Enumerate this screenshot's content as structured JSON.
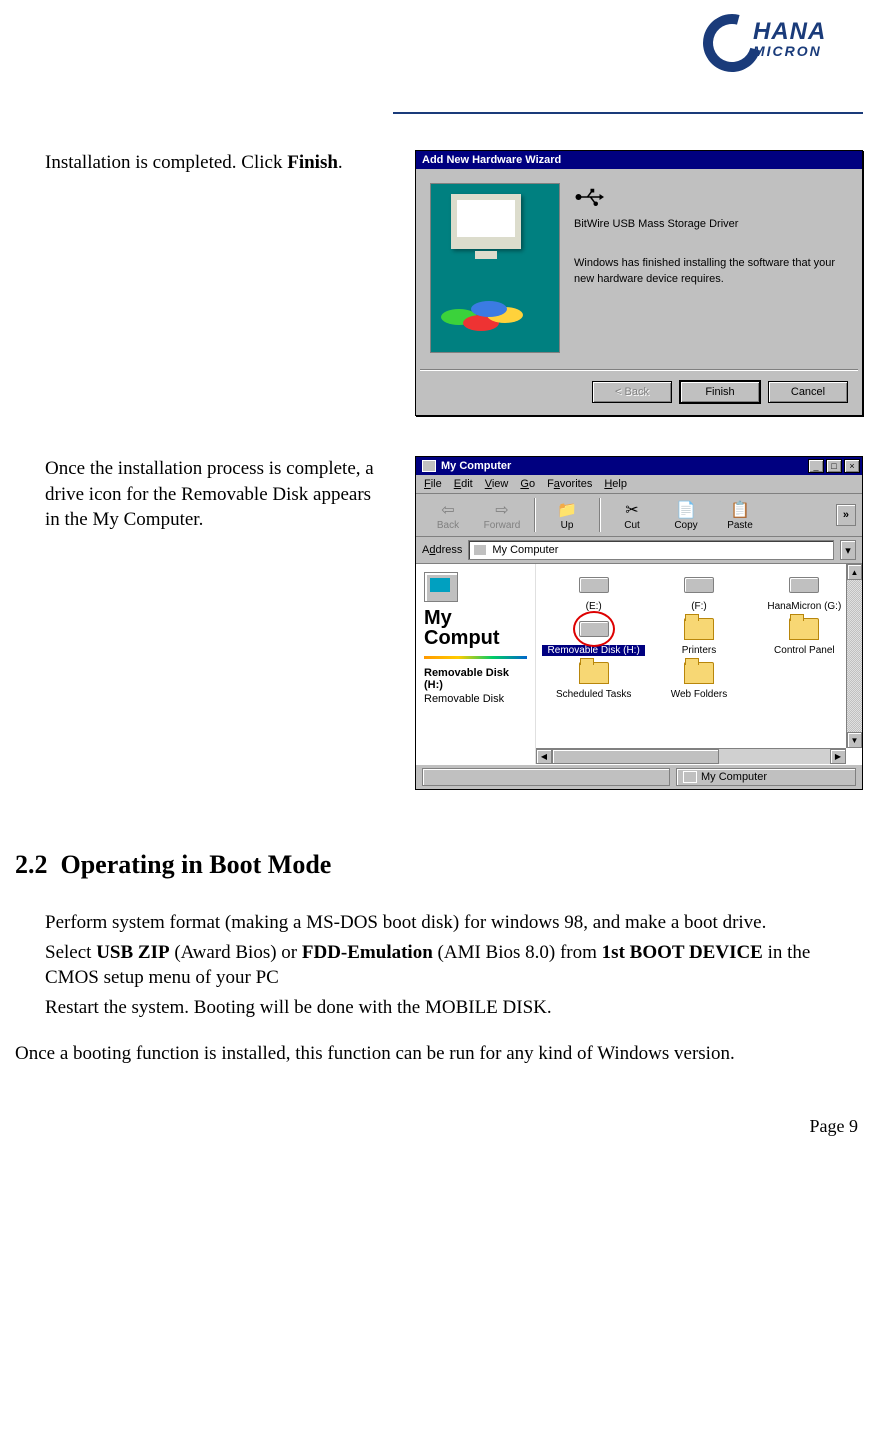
{
  "logo": {
    "line1": "HANA",
    "line2": "MICRON"
  },
  "step1": {
    "text_pre": "Installation is completed.  Click ",
    "text_bold": "Finish",
    "text_post": "."
  },
  "wizard": {
    "title": "Add New Hardware Wizard",
    "driver": "BitWire USB Mass Storage Driver",
    "message": "Windows has finished installing the software that your new hardware device requires.",
    "btn_back": "< Back",
    "btn_finish": "Finish",
    "btn_cancel": "Cancel"
  },
  "step2": {
    "text": "Once the installation process is complete, a drive icon for the Removable Disk appears in the My Computer."
  },
  "mycomp": {
    "title": "My Computer",
    "win_min": "_",
    "win_max": "□",
    "win_close": "×",
    "menu": [
      "File",
      "Edit",
      "View",
      "Go",
      "Favorites",
      "Help"
    ],
    "tool_back": "Back",
    "tool_forward": "Forward",
    "tool_up": "Up",
    "tool_cut": "Cut",
    "tool_copy": "Copy",
    "tool_paste": "Paste",
    "tool_more": "»",
    "addr_label": "Address",
    "addr_value": "My Computer",
    "side_title": "My Comput",
    "side_sel_title": "Removable Disk (H:)",
    "side_sel_sub": "Removable Disk",
    "icons": [
      {
        "label": "(E:)",
        "type": "drive"
      },
      {
        "label": "(F:)",
        "type": "drive"
      },
      {
        "label": "HanaMicron (G:)",
        "type": "drive"
      },
      {
        "label": "Removable Disk (H:)",
        "type": "drive",
        "highlight": true
      },
      {
        "label": "Printers",
        "type": "folder"
      },
      {
        "label": "Control Panel",
        "type": "folder"
      },
      {
        "label": "Scheduled Tasks",
        "type": "folder"
      },
      {
        "label": "Web Folders",
        "type": "folder"
      }
    ],
    "status_right": "My Computer"
  },
  "section": {
    "number": "2.2",
    "title": "Operating in Boot Mode"
  },
  "boot_steps": {
    "s1": "Perform system format (making a MS-DOS boot disk) for windows 98, and make a boot drive.",
    "s2_pre": "Select ",
    "s2_b1": "USB ZIP",
    "s2_mid1": " (Award Bios) or ",
    "s2_b2": "FDD-Emulation",
    "s2_mid2": " (AMI Bios 8.0) from ",
    "s2_b3": "1st BOOT DEVICE",
    "s2_post": " in the CMOS setup menu of your PC",
    "s3": "Restart the system.  Booting will be done with the MOBILE DISK."
  },
  "closing": "Once a booting function is installed, this function can be run for any kind of Windows version.",
  "footer": "Page 9"
}
